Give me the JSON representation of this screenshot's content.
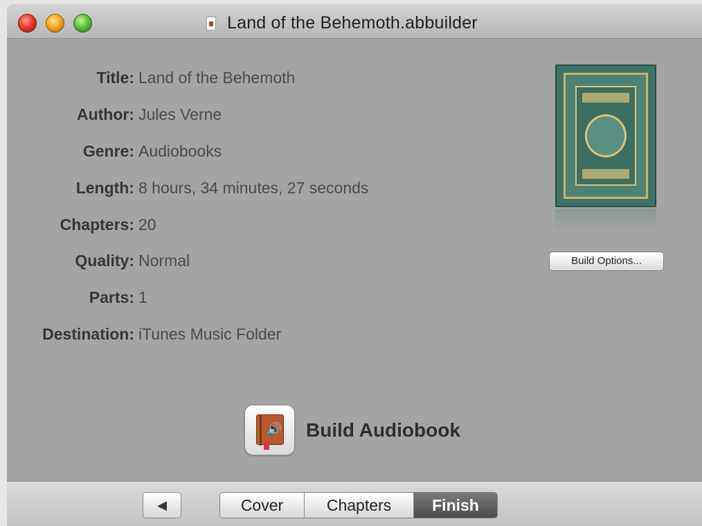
{
  "window": {
    "title": "Land of the Behemoth.abbuilder"
  },
  "fields": [
    {
      "label": "Title:",
      "value": "Land of the Behemoth"
    },
    {
      "label": "Author:",
      "value": "Jules Verne"
    },
    {
      "label": "Genre:",
      "value": "Audiobooks"
    },
    {
      "label": "Length:",
      "value": "8 hours, 34 minutes, 27 seconds"
    },
    {
      "label": "Chapters:",
      "value": "20"
    },
    {
      "label": "Quality:",
      "value": "Normal"
    },
    {
      "label": "Parts:",
      "value": "1"
    },
    {
      "label": "Destination:",
      "value": "iTunes Music Folder"
    }
  ],
  "actions": {
    "build_options_label": "Build Options...",
    "build_audiobook_label": "Build Audiobook"
  },
  "toolbar": {
    "back_glyph": "◀",
    "tabs": [
      "Cover",
      "Chapters",
      "Finish"
    ],
    "selected_tab": "Finish"
  },
  "icons": {
    "doc": "document-icon",
    "audiobook": "audiobook-icon",
    "cover": "book-cover-image"
  },
  "colors": {
    "window_bg": "#a4a4a4",
    "selected_tab_bg": "#5e5e5e"
  }
}
